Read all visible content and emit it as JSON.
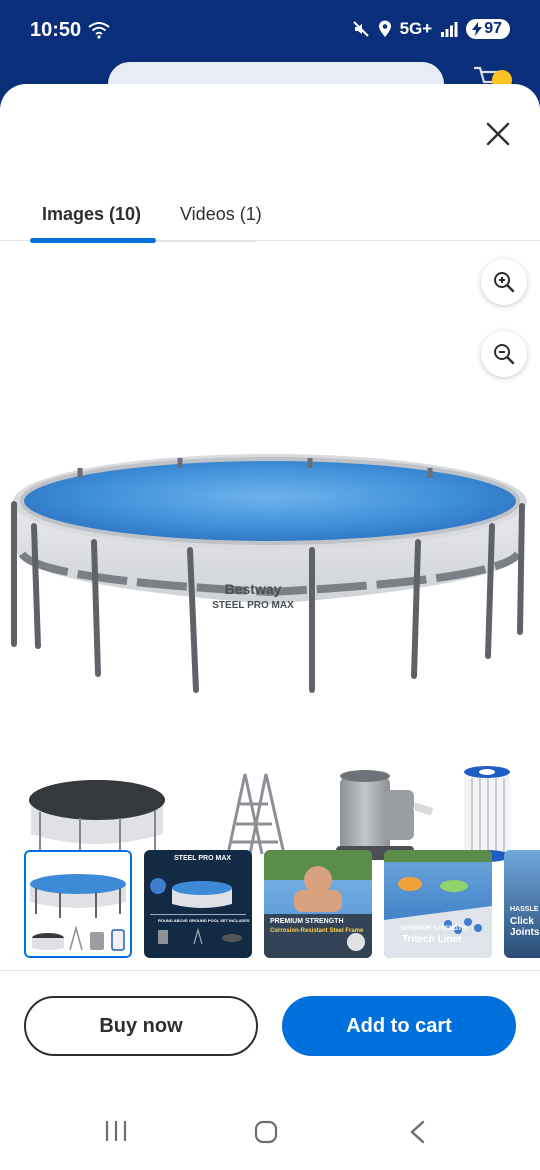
{
  "status_bar": {
    "time": "10:50",
    "network": "5G+",
    "battery": "97"
  },
  "tabs": [
    {
      "label": "Images (10)",
      "active": true
    },
    {
      "label": "Videos (1)",
      "active": false
    }
  ],
  "zoom": {
    "in_icon": "zoom-in-icon",
    "out_icon": "zoom-out-icon"
  },
  "main_image": {
    "brand_text": "Bestway",
    "model_text": "STEEL PRO MAX"
  },
  "thumbnails": [
    {
      "name": "pool-with-accessories",
      "selected": true
    },
    {
      "name": "steel-pro-max-set",
      "caption_top": "STEEL PRO MAX",
      "caption_bottom": "ROUND ABOVE GROUND POOL SET INCLUDES",
      "selected": false
    },
    {
      "name": "premium-strength",
      "caption_title": "PREMIUM STRENGTH",
      "caption_sub": "Corrosion-Resistant Steel Frame",
      "selected": false
    },
    {
      "name": "superior-strength",
      "caption_title": "SUPERIOR STRENGTH",
      "caption_sub": "Tritech Liner",
      "selected": false
    },
    {
      "name": "hassle-free",
      "caption_title": "HASSLE",
      "caption_sub": "Click Joints",
      "selected": false
    }
  ],
  "actions": {
    "buy_now": "Buy now",
    "add_to_cart": "Add to cart"
  },
  "colors": {
    "brand_blue": "#0071dc",
    "header_navy": "#0b2e7a",
    "badge_yellow": "#ffc220"
  }
}
